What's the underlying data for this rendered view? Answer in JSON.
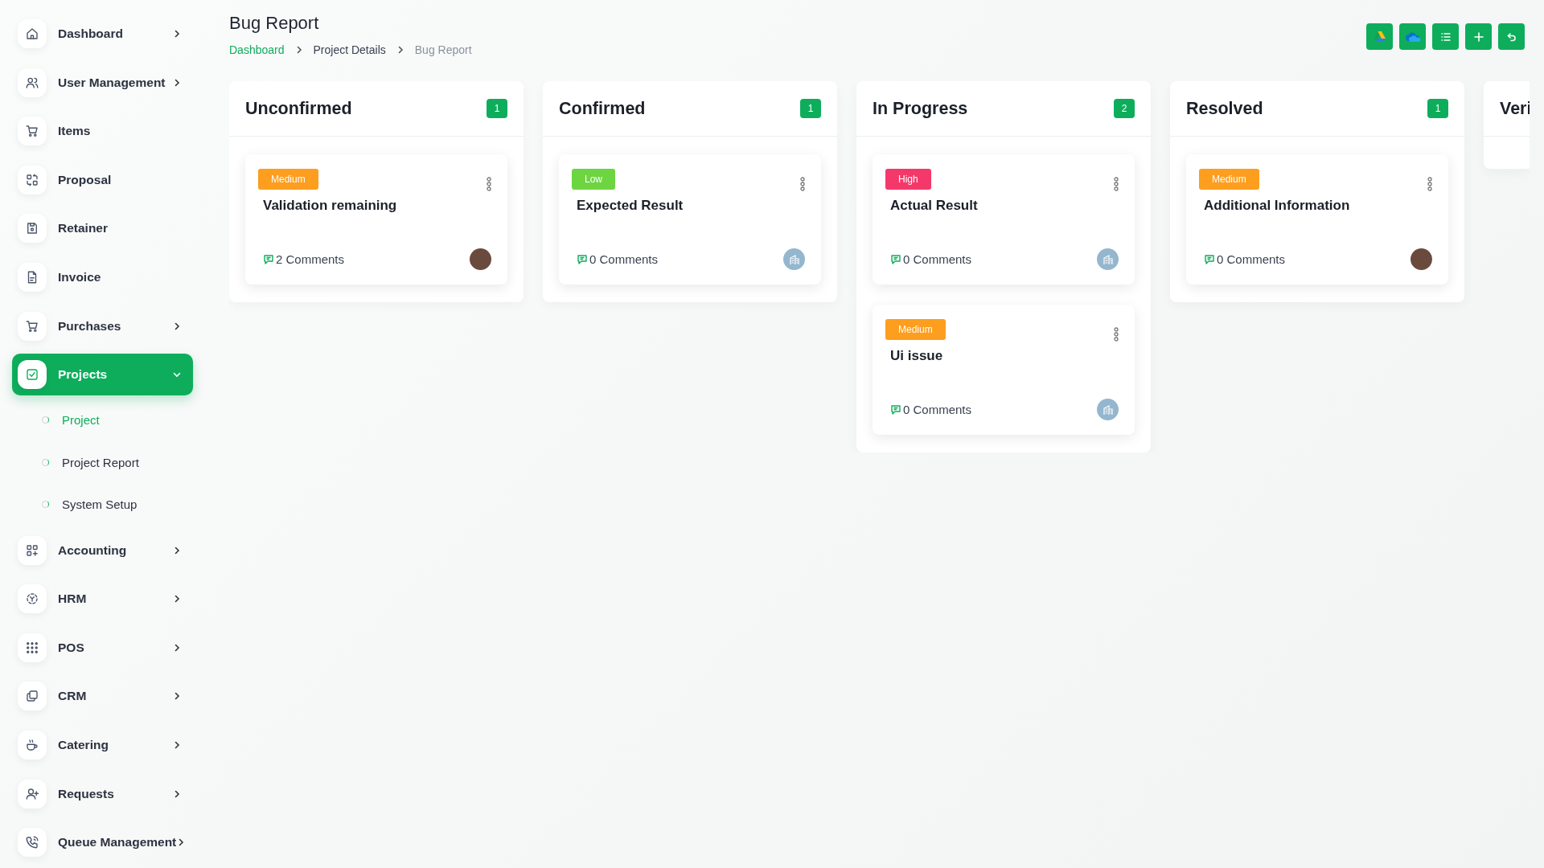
{
  "sidebar": {
    "items": [
      {
        "label": "Dashboard",
        "kind": "group",
        "expanded": false,
        "selected": false
      },
      {
        "label": "User Management",
        "kind": "group",
        "expanded": false,
        "selected": false
      },
      {
        "label": "Items",
        "kind": "link",
        "selected": false
      },
      {
        "label": "Proposal",
        "kind": "link",
        "selected": false
      },
      {
        "label": "Retainer",
        "kind": "link",
        "selected": false
      },
      {
        "label": "Invoice",
        "kind": "link",
        "selected": false
      },
      {
        "label": "Purchases",
        "kind": "group",
        "expanded": false,
        "selected": false
      },
      {
        "label": "Projects",
        "kind": "group",
        "expanded": true,
        "selected": true,
        "children": [
          {
            "label": "Project",
            "selected": true
          },
          {
            "label": "Project Report",
            "selected": false
          },
          {
            "label": "System Setup",
            "selected": false
          }
        ]
      },
      {
        "label": "Accounting",
        "kind": "group",
        "expanded": false,
        "selected": false
      },
      {
        "label": "HRM",
        "kind": "group",
        "expanded": false,
        "selected": false
      },
      {
        "label": "POS",
        "kind": "group",
        "expanded": false,
        "selected": false
      },
      {
        "label": "CRM",
        "kind": "group",
        "expanded": false,
        "selected": false
      },
      {
        "label": "Catering",
        "kind": "group",
        "expanded": false,
        "selected": false
      },
      {
        "label": "Requests",
        "kind": "group",
        "expanded": false,
        "selected": false
      },
      {
        "label": "Queue Management",
        "kind": "group",
        "expanded": false,
        "selected": false
      }
    ]
  },
  "page": {
    "title": "Bug Report",
    "breadcrumb": [
      {
        "label": "Dashboard",
        "kind": "link"
      },
      {
        "label": "Project Details",
        "kind": "link"
      },
      {
        "label": "Bug Report",
        "kind": "current"
      }
    ]
  },
  "toolbar": {
    "buttons": [
      {
        "kind": "drive"
      },
      {
        "kind": "cloud"
      },
      {
        "kind": "list"
      },
      {
        "kind": "add"
      },
      {
        "kind": "back"
      }
    ]
  },
  "board": {
    "columns": [
      {
        "title": "Unconfirmed",
        "count": "1",
        "cards": [
          {
            "priority": "Medium",
            "color": "#fd9e1f",
            "title": "Validation remaining",
            "comments": "2 Comments",
            "avatar": {
              "kind": "photo"
            }
          }
        ]
      },
      {
        "title": "Confirmed",
        "count": "1",
        "cards": [
          {
            "priority": "Low",
            "color": "#6dd540",
            "title": "Expected Result",
            "comments": "0 Comments",
            "avatar": {
              "kind": "building"
            }
          }
        ]
      },
      {
        "title": "In Progress",
        "count": "2",
        "cards": [
          {
            "priority": "High",
            "color": "#f5386a",
            "title": "Actual Result",
            "comments": "0 Comments",
            "avatar": {
              "kind": "building"
            }
          },
          {
            "priority": "Medium",
            "color": "#fd9e1f",
            "title": "Ui issue",
            "comments": "0 Comments",
            "avatar": {
              "kind": "building"
            }
          }
        ]
      },
      {
        "title": "Resolved",
        "count": "1",
        "cards": [
          {
            "priority": "Medium",
            "color": "#fd9e1f",
            "title": "Additional Information",
            "comments": "0 Comments",
            "avatar": {
              "kind": "photo"
            }
          }
        ]
      },
      {
        "title": "Veri"
      }
    ]
  }
}
